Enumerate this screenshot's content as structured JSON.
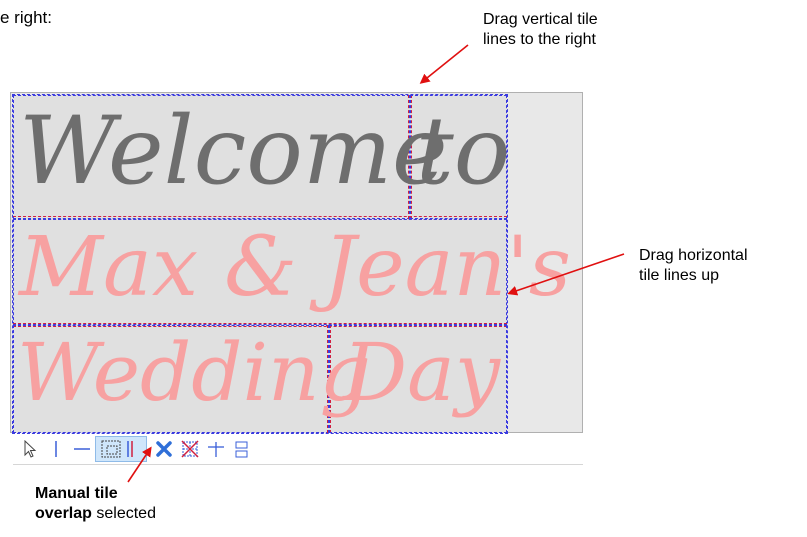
{
  "intro": {
    "text": "e right:"
  },
  "annotations": {
    "vertical_line1": "Drag vertical tile",
    "vertical_line2": "lines to the right",
    "horizontal_line1": "Drag horizontal",
    "horizontal_line2": "tile lines up",
    "manual_bold_line1": "Manual tile",
    "manual_bold_line2": "overlap",
    "manual_rest": " selected"
  },
  "design": {
    "row1": {
      "word1": "Welcome",
      "word2": "to"
    },
    "row2": {
      "text": "Max & Jean's"
    },
    "row3": {
      "word1": "Wedding",
      "word2": "Day"
    }
  },
  "colors": {
    "gray_text": "#6e6e6e",
    "pink_text": "#f7a1a1",
    "tile_line_blue": "#3a3ae0",
    "tile_line_red": "#d02040",
    "arrow_red": "#e01010",
    "selected_bg": "#cfe6fb"
  },
  "toolbar": {
    "tools": [
      {
        "name": "select-arrow-icon"
      },
      {
        "name": "vertical-line-icon"
      },
      {
        "name": "horizontal-line-icon"
      },
      {
        "name": "manual-tile-overlap-icon",
        "selected": true
      },
      {
        "name": "delete-x-icon"
      },
      {
        "name": "clear-tiles-icon"
      },
      {
        "name": "crosshair-icon"
      },
      {
        "name": "align-boxes-icon"
      }
    ]
  }
}
